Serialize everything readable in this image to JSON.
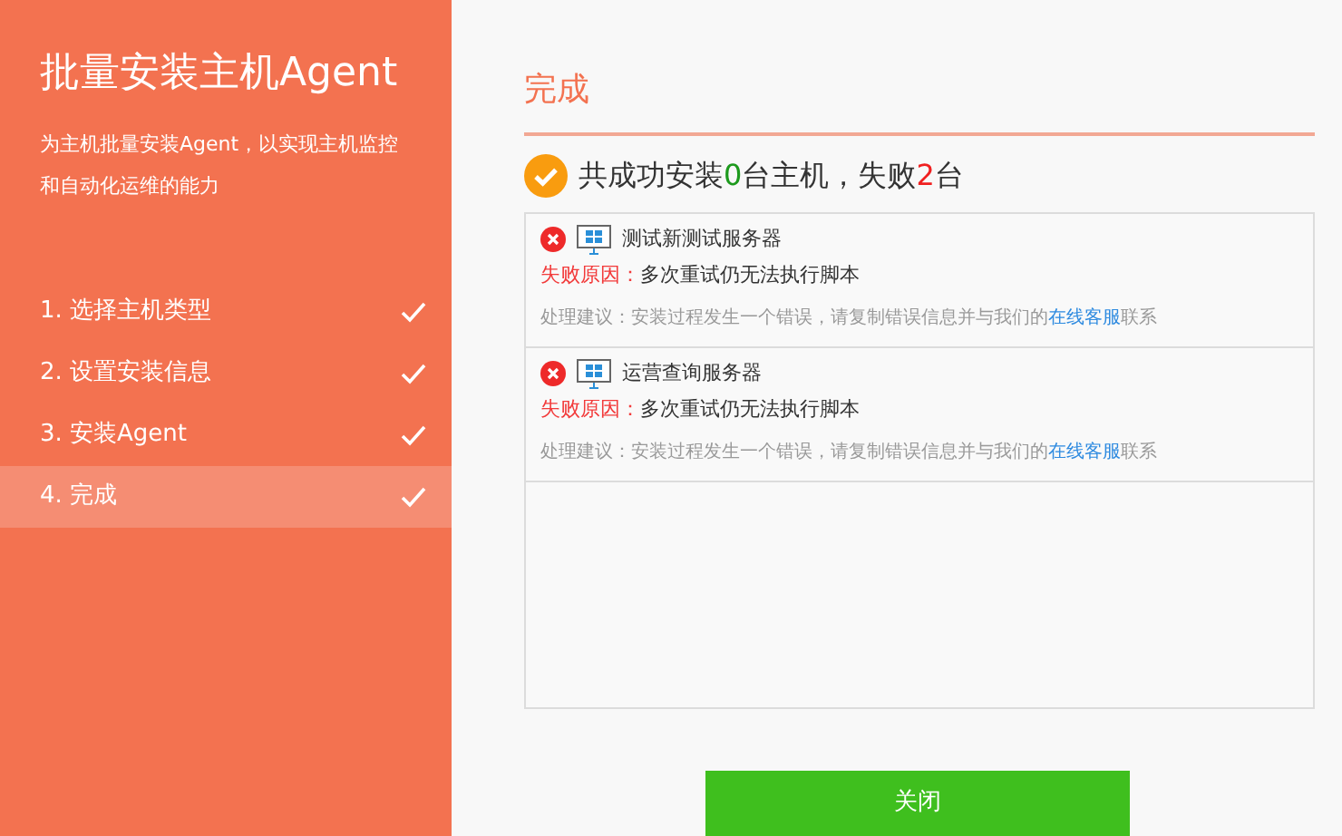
{
  "sidebar": {
    "title": "批量安装主机Agent",
    "description": "为主机批量安装Agent，以实现主机监控和自动化运维的能力",
    "steps": [
      {
        "label": "1. 选择主机类型",
        "done": true,
        "selected": false
      },
      {
        "label": "2. 设置安装信息",
        "done": true,
        "selected": false
      },
      {
        "label": "3. 安装Agent",
        "done": true,
        "selected": false
      },
      {
        "label": "4. 完成",
        "done": true,
        "selected": true
      }
    ]
  },
  "main": {
    "title": "完成",
    "summary": {
      "before": "共成功安装",
      "success_count": "0",
      "middle": "台主机，失败",
      "fail_count": "2",
      "after": "台"
    },
    "results": [
      {
        "failed": true,
        "host": "测试新测试服务器",
        "reason_label": "失败原因：",
        "reason": "多次重试仍无法执行脚本",
        "advice": "处理建议：安装过程发生一个错误，请复制错误信息并与我们的",
        "link": "在线客服",
        "advice_end": "联系"
      },
      {
        "failed": true,
        "host": "运营查询服务器",
        "reason_label": "失败原因：",
        "reason": "多次重试仍无法执行脚本",
        "advice": "处理建议：安装过程发生一个错误，请复制错误信息并与我们的",
        "link": "在线客服",
        "advice_end": "联系"
      }
    ],
    "close_button": "关闭"
  }
}
